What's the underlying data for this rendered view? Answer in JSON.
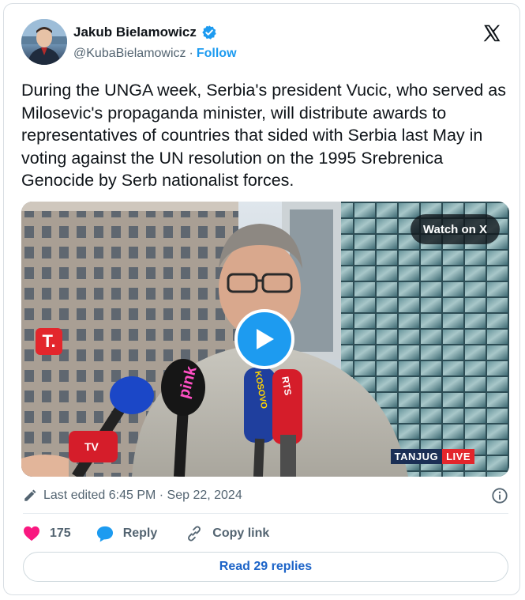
{
  "author": {
    "name": "Jakub Bielamowicz",
    "handle": "@KubaBielamowicz",
    "separator": "·",
    "follow_label": "Follow"
  },
  "tweet": {
    "text": "During the UNGA week, Serbia's president Vucic, who served as Milosevic's propaganda minister, will distribute awards to representatives of countries that sided with Serbia last May in voting against the UN resolution on the 1995 Srebrenica Genocide by Serb nationalist forces."
  },
  "media": {
    "watch_label": "Watch on X",
    "channel_logo_text": "T.",
    "badge_left": "TANJUG",
    "badge_right": "LIVE",
    "mic_labels": [
      "pink",
      "KOSOVO",
      "RTS",
      "TV"
    ]
  },
  "meta": {
    "edited_label": "Last edited 6:45 PM · Sep 22, 2024"
  },
  "actions": {
    "likes_count": "175",
    "reply_label": "Reply",
    "copy_link_label": "Copy link"
  },
  "footer": {
    "read_replies_label": "Read 29 replies"
  },
  "colors": {
    "accent": "#1d9bf0",
    "like": "#f91880",
    "text": "#0f1419",
    "muted": "#536471"
  },
  "icons": [
    "verified-badge-icon",
    "x-logo-icon",
    "play-icon",
    "pencil-icon",
    "info-icon",
    "heart-icon",
    "reply-bubble-icon",
    "link-icon"
  ]
}
